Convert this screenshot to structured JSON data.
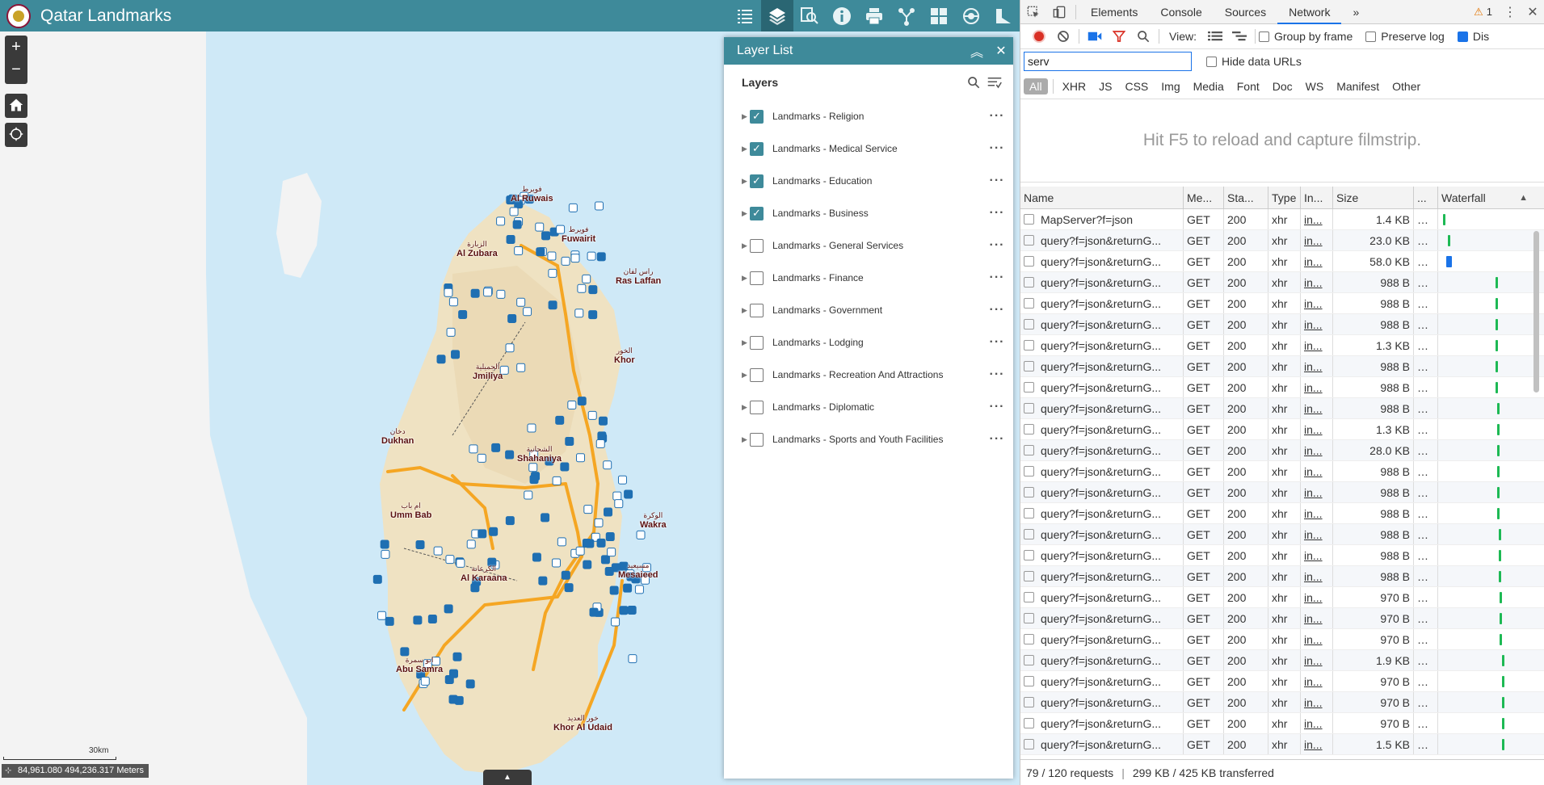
{
  "app": {
    "title": "Qatar Landmarks",
    "accent": "#3e8a9a",
    "toolbar": [
      "legend-icon",
      "layers-icon",
      "query-icon",
      "info-icon",
      "print-icon",
      "analysis-icon",
      "gallery-icon",
      "basemap-icon",
      "measure-icon"
    ]
  },
  "map": {
    "zoom_in": "+",
    "zoom_out": "−",
    "scale_label": "30km",
    "coordinates": "84,961.080 494,236.317 Meters",
    "places": [
      {
        "ar": "فويرط",
        "en": "Al Ruwais"
      },
      {
        "ar": "فويرط",
        "en": "Fuwairit"
      },
      {
        "ar": "الزبارة",
        "en": "Al Zubara"
      },
      {
        "ar": "راس لفان",
        "en": "Ras Laffan"
      },
      {
        "ar": "الخور",
        "en": "Khor"
      },
      {
        "ar": "الجميلية",
        "en": "Jmiliya"
      },
      {
        "ar": "دخان",
        "en": "Dukhan"
      },
      {
        "ar": "الشحانية",
        "en": "Shahaniya"
      },
      {
        "ar": "ام باب",
        "en": "Umm Bab"
      },
      {
        "ar": "الوكرة",
        "en": "Wakra"
      },
      {
        "ar": "الكرعانة",
        "en": "Al Karaana"
      },
      {
        "ar": "مسيعيد",
        "en": "Mesaieed"
      },
      {
        "ar": "ابو سمرة",
        "en": "Abu Samra"
      },
      {
        "ar": "خور العديد",
        "en": "Khor Al Udaid"
      }
    ]
  },
  "layer_panel": {
    "title": "Layer List",
    "section_title": "Layers",
    "layers": [
      {
        "label": "Landmarks - Religion",
        "checked": true
      },
      {
        "label": "Landmarks - Medical Service",
        "checked": true
      },
      {
        "label": "Landmarks - Education",
        "checked": true
      },
      {
        "label": "Landmarks - Business",
        "checked": true
      },
      {
        "label": "Landmarks - General Services",
        "checked": false
      },
      {
        "label": "Landmarks - Finance",
        "checked": false
      },
      {
        "label": "Landmarks - Government",
        "checked": false
      },
      {
        "label": "Landmarks - Lodging",
        "checked": false
      },
      {
        "label": "Landmarks - Recreation And Attractions",
        "checked": false
      },
      {
        "label": "Landmarks - Diplomatic",
        "checked": false
      },
      {
        "label": "Landmarks - Sports and Youth Facilities",
        "checked": false
      }
    ]
  },
  "devtools": {
    "tabs": [
      "Elements",
      "Console",
      "Sources",
      "Network"
    ],
    "active_tab": "Network",
    "more": "»",
    "warnings": "1",
    "controls": {
      "view_label": "View:",
      "group_by_frame": "Group by frame",
      "preserve_log": "Preserve log",
      "disable_cache": "Dis"
    },
    "filter": {
      "value": "serv",
      "hide_data_urls": "Hide data URLs"
    },
    "types": [
      "All",
      "XHR",
      "JS",
      "CSS",
      "Img",
      "Media",
      "Font",
      "Doc",
      "WS",
      "Manifest",
      "Other"
    ],
    "filmstrip_hint": "Hit F5 to reload and capture filmstrip.",
    "columns": [
      "Name",
      "Me...",
      "Sta...",
      "Type",
      "In...",
      "Size",
      "...",
      "Waterfall"
    ],
    "rows": [
      {
        "name": "MapServer?f=json",
        "method": "GET",
        "status": "200",
        "type": "xhr",
        "init": "in...",
        "size": "1.4 KB",
        "wf": 0.02,
        "wfBlue": false
      },
      {
        "name": "query?f=json&returnG...",
        "method": "GET",
        "status": "200",
        "type": "xhr",
        "init": "in...",
        "size": "23.0 KB",
        "wf": 0.07,
        "wfBlue": false
      },
      {
        "name": "query?f=json&returnG...",
        "method": "GET",
        "status": "200",
        "type": "xhr",
        "init": "in...",
        "size": "58.0 KB",
        "wf": 0.06,
        "wfBlue": true
      },
      {
        "name": "query?f=json&returnG...",
        "method": "GET",
        "status": "200",
        "type": "xhr",
        "init": "in...",
        "size": "988 B",
        "wf": 0.62,
        "wfBlue": false
      },
      {
        "name": "query?f=json&returnG...",
        "method": "GET",
        "status": "200",
        "type": "xhr",
        "init": "in...",
        "size": "988 B",
        "wf": 0.62,
        "wfBlue": false
      },
      {
        "name": "query?f=json&returnG...",
        "method": "GET",
        "status": "200",
        "type": "xhr",
        "init": "in...",
        "size": "988 B",
        "wf": 0.62,
        "wfBlue": false
      },
      {
        "name": "query?f=json&returnG...",
        "method": "GET",
        "status": "200",
        "type": "xhr",
        "init": "in...",
        "size": "1.3 KB",
        "wf": 0.62,
        "wfBlue": false
      },
      {
        "name": "query?f=json&returnG...",
        "method": "GET",
        "status": "200",
        "type": "xhr",
        "init": "in...",
        "size": "988 B",
        "wf": 0.62,
        "wfBlue": false
      },
      {
        "name": "query?f=json&returnG...",
        "method": "GET",
        "status": "200",
        "type": "xhr",
        "init": "in...",
        "size": "988 B",
        "wf": 0.62,
        "wfBlue": false
      },
      {
        "name": "query?f=json&returnG...",
        "method": "GET",
        "status": "200",
        "type": "xhr",
        "init": "in...",
        "size": "988 B",
        "wf": 0.64,
        "wfBlue": false
      },
      {
        "name": "query?f=json&returnG...",
        "method": "GET",
        "status": "200",
        "type": "xhr",
        "init": "in...",
        "size": "1.3 KB",
        "wf": 0.64,
        "wfBlue": false
      },
      {
        "name": "query?f=json&returnG...",
        "method": "GET",
        "status": "200",
        "type": "xhr",
        "init": "in...",
        "size": "28.0 KB",
        "wf": 0.64,
        "wfBlue": false
      },
      {
        "name": "query?f=json&returnG...",
        "method": "GET",
        "status": "200",
        "type": "xhr",
        "init": "in...",
        "size": "988 B",
        "wf": 0.64,
        "wfBlue": false
      },
      {
        "name": "query?f=json&returnG...",
        "method": "GET",
        "status": "200",
        "type": "xhr",
        "init": "in...",
        "size": "988 B",
        "wf": 0.64,
        "wfBlue": false
      },
      {
        "name": "query?f=json&returnG...",
        "method": "GET",
        "status": "200",
        "type": "xhr",
        "init": "in...",
        "size": "988 B",
        "wf": 0.64,
        "wfBlue": false
      },
      {
        "name": "query?f=json&returnG...",
        "method": "GET",
        "status": "200",
        "type": "xhr",
        "init": "in...",
        "size": "988 B",
        "wf": 0.66,
        "wfBlue": false
      },
      {
        "name": "query?f=json&returnG...",
        "method": "GET",
        "status": "200",
        "type": "xhr",
        "init": "in...",
        "size": "988 B",
        "wf": 0.66,
        "wfBlue": false
      },
      {
        "name": "query?f=json&returnG...",
        "method": "GET",
        "status": "200",
        "type": "xhr",
        "init": "in...",
        "size": "988 B",
        "wf": 0.66,
        "wfBlue": false
      },
      {
        "name": "query?f=json&returnG...",
        "method": "GET",
        "status": "200",
        "type": "xhr",
        "init": "in...",
        "size": "970 B",
        "wf": 0.67,
        "wfBlue": false
      },
      {
        "name": "query?f=json&returnG...",
        "method": "GET",
        "status": "200",
        "type": "xhr",
        "init": "in...",
        "size": "970 B",
        "wf": 0.67,
        "wfBlue": false
      },
      {
        "name": "query?f=json&returnG...",
        "method": "GET",
        "status": "200",
        "type": "xhr",
        "init": "in...",
        "size": "970 B",
        "wf": 0.67,
        "wfBlue": false
      },
      {
        "name": "query?f=json&returnG...",
        "method": "GET",
        "status": "200",
        "type": "xhr",
        "init": "in...",
        "size": "1.9 KB",
        "wf": 0.69,
        "wfBlue": false
      },
      {
        "name": "query?f=json&returnG...",
        "method": "GET",
        "status": "200",
        "type": "xhr",
        "init": "in...",
        "size": "970 B",
        "wf": 0.69,
        "wfBlue": false
      },
      {
        "name": "query?f=json&returnG...",
        "method": "GET",
        "status": "200",
        "type": "xhr",
        "init": "in...",
        "size": "970 B",
        "wf": 0.69,
        "wfBlue": false
      },
      {
        "name": "query?f=json&returnG...",
        "method": "GET",
        "status": "200",
        "type": "xhr",
        "init": "in...",
        "size": "970 B",
        "wf": 0.69,
        "wfBlue": false
      },
      {
        "name": "query?f=json&returnG...",
        "method": "GET",
        "status": "200",
        "type": "xhr",
        "init": "in...",
        "size": "1.5 KB",
        "wf": 0.69,
        "wfBlue": false
      }
    ],
    "status": {
      "requests": "79 / 120 requests",
      "transferred": "299 KB / 425 KB transferred"
    }
  }
}
